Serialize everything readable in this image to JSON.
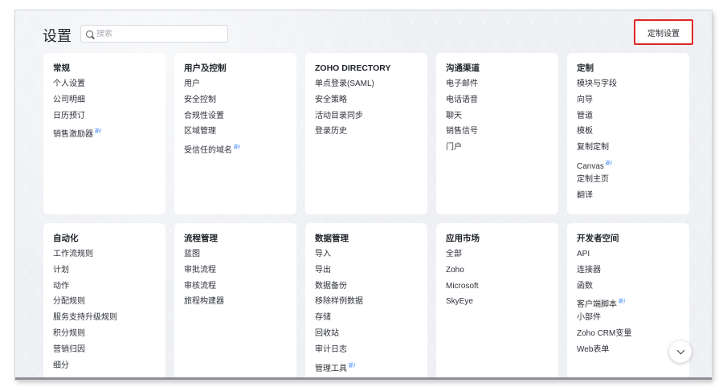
{
  "header": {
    "title": "设置",
    "search_placeholder": "搜索",
    "customize_button": "定制设置"
  },
  "new_badge": "新!",
  "sections": [
    {
      "title": "常规",
      "items": [
        {
          "label": "个人设置"
        },
        {
          "label": "公司明细"
        },
        {
          "label": "日历预订"
        },
        {
          "label": "销售激励器",
          "new": true
        }
      ]
    },
    {
      "title": "用户及控制",
      "items": [
        {
          "label": "用户"
        },
        {
          "label": "安全控制"
        },
        {
          "label": "合规性设置"
        },
        {
          "label": "区域管理"
        },
        {
          "label": "受信任的域名",
          "new": true
        }
      ]
    },
    {
      "title": "ZOHO DIRECTORY",
      "items": [
        {
          "label": "单点登录(SAML)"
        },
        {
          "label": "安全策略"
        },
        {
          "label": "活动目录同步"
        },
        {
          "label": "登录历史"
        }
      ]
    },
    {
      "title": "沟通渠道",
      "items": [
        {
          "label": "电子邮件"
        },
        {
          "label": "电话语音"
        },
        {
          "label": "聊天"
        },
        {
          "label": "销售信号"
        },
        {
          "label": "门户"
        }
      ]
    },
    {
      "title": "定制",
      "items": [
        {
          "label": "模块与字段"
        },
        {
          "label": "向导"
        },
        {
          "label": "管道"
        },
        {
          "label": "模板"
        },
        {
          "label": "复制定制"
        },
        {
          "label": "Canvas",
          "new": true
        },
        {
          "label": "定制主页"
        },
        {
          "label": "翻译"
        }
      ]
    },
    {
      "title": "自动化",
      "items": [
        {
          "label": "工作流规则"
        },
        {
          "label": "计划"
        },
        {
          "label": "动作"
        },
        {
          "label": "分配规则"
        },
        {
          "label": "服务支持升级规则"
        },
        {
          "label": "积分规则"
        },
        {
          "label": "营销归因"
        },
        {
          "label": "细分"
        }
      ]
    },
    {
      "title": "流程管理",
      "items": [
        {
          "label": "蓝图"
        },
        {
          "label": "审批流程"
        },
        {
          "label": "审核流程"
        },
        {
          "label": "旅程构建器"
        }
      ]
    },
    {
      "title": "数据管理",
      "items": [
        {
          "label": "导入"
        },
        {
          "label": "导出"
        },
        {
          "label": "数据备份"
        },
        {
          "label": " 移除样例数据"
        },
        {
          "label": "存储"
        },
        {
          "label": "回收站"
        },
        {
          "label": "审计日志"
        },
        {
          "label": "管理工具",
          "new": true
        }
      ]
    },
    {
      "title": "应用市场",
      "items": [
        {
          "label": "全部"
        },
        {
          "label": "Zoho"
        },
        {
          "label": "Microsoft"
        },
        {
          "label": "SkyEye"
        }
      ]
    },
    {
      "title": "开发者空间",
      "items": [
        {
          "label": "API"
        },
        {
          "label": "连接器"
        },
        {
          "label": "函数"
        },
        {
          "label": "客户端脚本",
          "new": true
        },
        {
          "label": "小部件"
        },
        {
          "label": "Zoho CRM变量"
        },
        {
          "label": "Web表单"
        }
      ]
    }
  ]
}
